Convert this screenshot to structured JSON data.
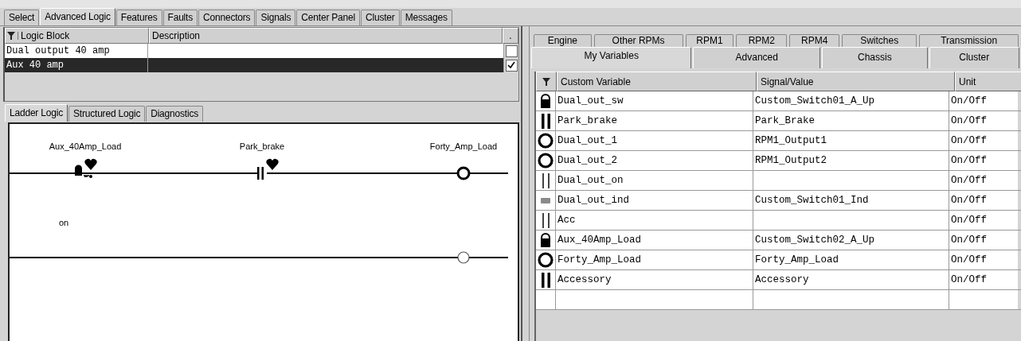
{
  "main_tabs": [
    {
      "label": "Select",
      "selected": false
    },
    {
      "label": "Advanced Logic",
      "selected": true
    },
    {
      "label": "Features",
      "selected": false
    },
    {
      "label": "Faults",
      "selected": false
    },
    {
      "label": "Connectors",
      "selected": false
    },
    {
      "label": "Signals",
      "selected": false
    },
    {
      "label": "Center Panel",
      "selected": false
    },
    {
      "label": "Cluster",
      "selected": false
    },
    {
      "label": "Messages",
      "selected": false
    }
  ],
  "logic_table": {
    "columns": [
      "Logic Block",
      "Description",
      "."
    ],
    "rows": [
      {
        "logic_block": "Dual output 40 amp",
        "selected": false,
        "checked": false
      },
      {
        "logic_block": "Aux 40 amp",
        "selected": true,
        "checked": true
      }
    ]
  },
  "logic_tabs": [
    {
      "label": "Ladder Logic",
      "selected": true
    },
    {
      "label": "Structured Logic",
      "selected": false
    },
    {
      "label": "Diagnostics",
      "selected": false
    }
  ],
  "ladder": {
    "rungs": [
      {
        "elements": [
          {
            "kind": "switch",
            "label": "Aux_40Amp_Load",
            "marked": true
          },
          {
            "kind": "contact",
            "label": "Park_brake",
            "marked": true
          }
        ],
        "coil": {
          "label": "Forty_Amp_Load",
          "bold": true
        }
      },
      {
        "comment": "on",
        "coil": {
          "bold": false
        }
      }
    ]
  },
  "variable_tabs_back": [
    {
      "label": "Engine",
      "selected": false
    },
    {
      "label": "Other RPMs",
      "selected": false
    },
    {
      "label": "RPM1",
      "selected": false
    },
    {
      "label": "RPM2",
      "selected": false
    },
    {
      "label": "RPM4",
      "selected": false
    },
    {
      "label": "Switches",
      "selected": false
    },
    {
      "label": "Transmission",
      "selected": false
    }
  ],
  "variable_tabs_front": [
    {
      "label": "My Variables",
      "selected": true
    },
    {
      "label": "Advanced",
      "selected": false
    },
    {
      "label": "Chassis",
      "selected": false
    },
    {
      "label": "Cluster",
      "selected": false
    }
  ],
  "variables_table": {
    "columns": [
      "Custom Variable",
      "Signal/Value",
      "Unit"
    ],
    "rows": [
      {
        "kind": "switch",
        "name": "Dual_out_sw",
        "signal": "Custom_Switch01_A_Up",
        "unit": "On/Off"
      },
      {
        "kind": "contact",
        "name": "Park_brake",
        "signal": "Park_Brake",
        "unit": "On/Off"
      },
      {
        "kind": "coil",
        "name": "Dual_out_1",
        "signal": "RPM1_Output1",
        "unit": "On/Off"
      },
      {
        "kind": "coil",
        "name": "Dual_out_2",
        "signal": "RPM1_Output2",
        "unit": "On/Off"
      },
      {
        "kind": "contact_dim",
        "name": "Dual_out_on",
        "unit": "On/Off"
      },
      {
        "kind": "indicator",
        "name": "Dual_out_ind",
        "signal": "Custom_Switch01_Ind",
        "unit": "On/Off"
      },
      {
        "kind": "contact_dim",
        "name": "Acc",
        "unit": "On/Off"
      },
      {
        "kind": "switch",
        "name": "Aux_40Amp_Load",
        "signal": "Custom_Switch02_A_Up",
        "unit": "On/Off"
      },
      {
        "kind": "coil",
        "name": "Forty_Amp_Load",
        "signal": "Forty_Amp_Load",
        "unit": "On/Off"
      },
      {
        "kind": "contact",
        "name": "Accessory",
        "signal": "Accessory",
        "unit": "On/Off"
      }
    ]
  }
}
